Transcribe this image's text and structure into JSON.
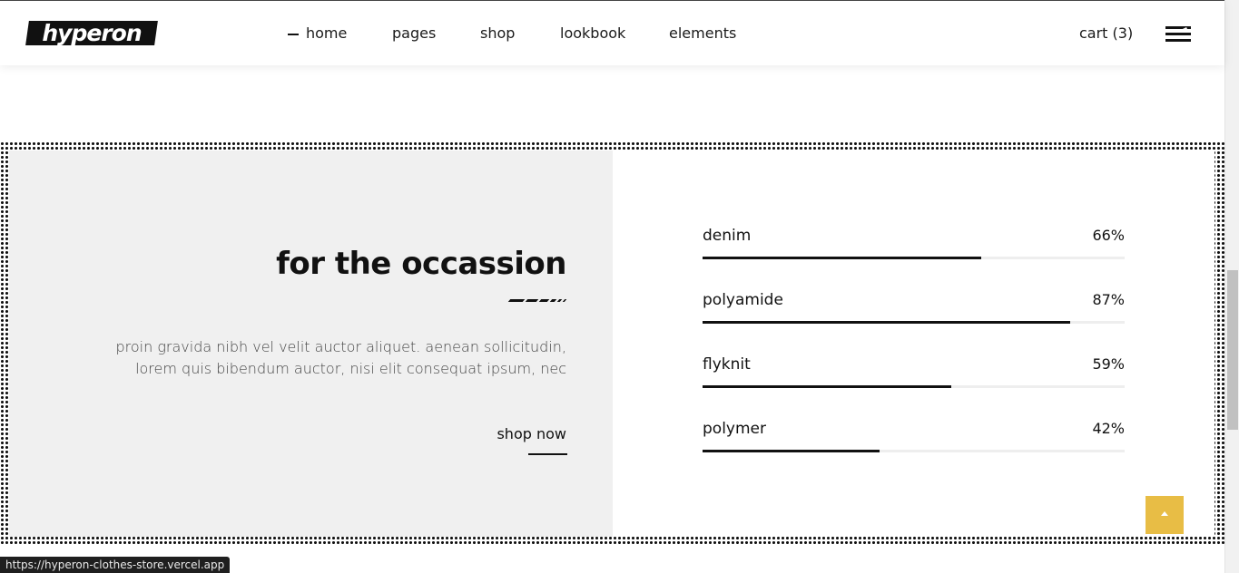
{
  "header": {
    "logo": "hyperon",
    "nav": [
      {
        "label": "home",
        "active": true
      },
      {
        "label": "pages",
        "active": false
      },
      {
        "label": "shop",
        "active": false
      },
      {
        "label": "lookbook",
        "active": false
      },
      {
        "label": "elements",
        "active": false
      }
    ],
    "cart_label": "cart (3)"
  },
  "promo": {
    "heading": "for the occassion",
    "description": "proin gravida nibh vel velit auctor aliquet. aenean sollicitudin, lorem quis bibendum auctor, nisi elit consequat ipsum, nec",
    "cta": "shop now"
  },
  "skills": [
    {
      "name": "denim",
      "percent_label": "66%",
      "value": 0.66
    },
    {
      "name": "polyamide",
      "percent_label": "87%",
      "value": 0.87
    },
    {
      "name": "flyknit",
      "percent_label": "59%",
      "value": 0.59
    },
    {
      "name": "polymer",
      "percent_label": "42%",
      "value": 0.42
    }
  ],
  "back_to_top": {
    "icon": "arrow-up-icon",
    "color": "#e8bd45"
  },
  "status_bar": {
    "url": "https://hyperon-clothes-store.vercel.app"
  }
}
